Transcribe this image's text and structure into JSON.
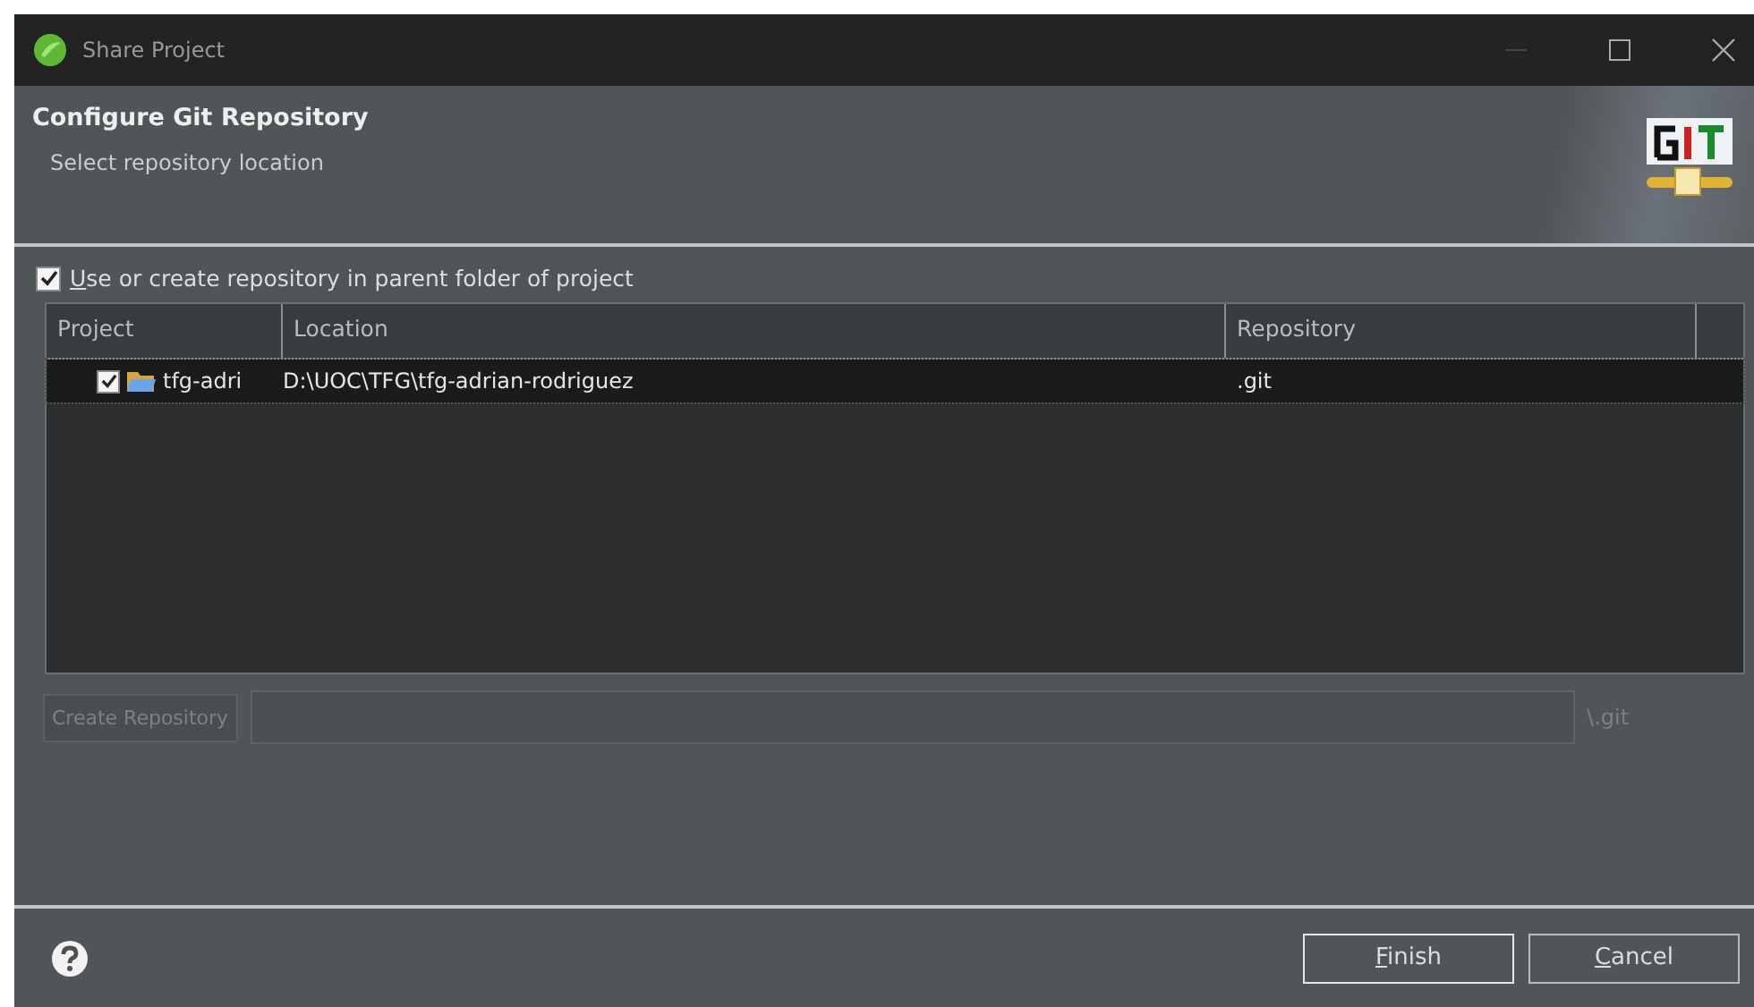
{
  "window": {
    "title": "Share Project"
  },
  "header": {
    "title": "Configure Git Repository",
    "subtitle": "Select repository location"
  },
  "parent_option": {
    "label": "Use or create repository in parent folder of project",
    "checked": true
  },
  "table": {
    "columns": [
      "Project",
      "Location",
      "Repository"
    ],
    "rows": [
      {
        "project": "tfg-adri",
        "location": "D:\\UOC\\TFG\\tfg-adrian-rodriguez",
        "repository": ".git",
        "checked": true,
        "selected": true
      }
    ]
  },
  "create_button": {
    "label": "Create Repository",
    "disabled": true
  },
  "path_field": {
    "disabled": true,
    "suffix": "\\.git"
  },
  "buttons": [
    {
      "label": "Finish",
      "kind": "primary"
    },
    {
      "label": "Cancel",
      "kind": "normal"
    }
  ]
}
